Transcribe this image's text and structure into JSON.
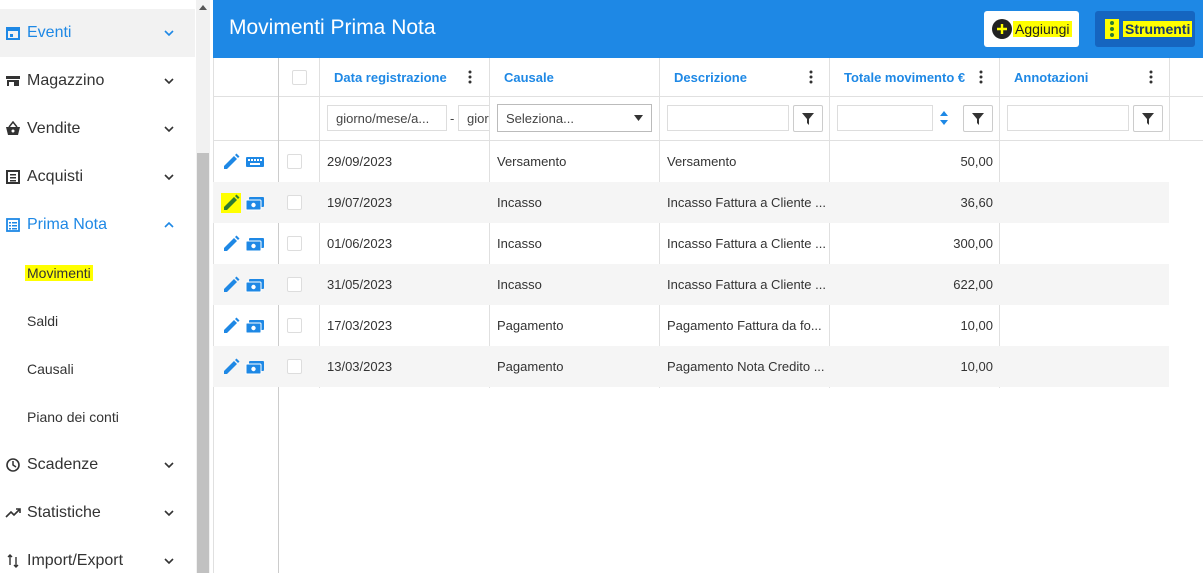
{
  "sidebar": {
    "items": [
      {
        "label": "Eventi",
        "icon": "calendar-icon"
      },
      {
        "label": "Magazzino",
        "icon": "store-icon"
      },
      {
        "label": "Vendite",
        "icon": "basket-icon"
      },
      {
        "label": "Acquisti",
        "icon": "receipt-icon"
      },
      {
        "label": "Prima Nota",
        "icon": "list-icon"
      },
      {
        "label": "Scadenze",
        "icon": "clock-icon"
      },
      {
        "label": "Statistiche",
        "icon": "trending-up-icon"
      },
      {
        "label": "Import/Export",
        "icon": "import-export-icon"
      }
    ],
    "subitems": [
      {
        "label": "Movimenti"
      },
      {
        "label": "Saldi"
      },
      {
        "label": "Causali"
      },
      {
        "label": "Piano dei conti"
      }
    ]
  },
  "header": {
    "title": "Movimenti Prima Nota",
    "add_label": "Aggiungi",
    "tools_label": "Strumenti"
  },
  "columns": {
    "date": "Data registrazione",
    "causale": "Causale",
    "descrizione": "Descrizione",
    "totale": "Totale movimento €",
    "annotazioni": "Annotazioni"
  },
  "filters": {
    "date_from_placeholder": "giorno/mese/a...",
    "date_separator": "-",
    "date_to_placeholder": "gior",
    "causale_select": "Seleziona..."
  },
  "rows": [
    {
      "date": "29/09/2023",
      "causale": "Versamento",
      "descrizione": "Versamento",
      "totale": "50,00",
      "annotazioni": ""
    },
    {
      "date": "19/07/2023",
      "causale": "Incasso",
      "descrizione": "Incasso Fattura a Cliente ...",
      "totale": "36,60",
      "annotazioni": ""
    },
    {
      "date": "01/06/2023",
      "causale": "Incasso",
      "descrizione": "Incasso Fattura a Cliente ...",
      "totale": "300,00",
      "annotazioni": ""
    },
    {
      "date": "31/05/2023",
      "causale": "Incasso",
      "descrizione": "Incasso Fattura a Cliente ...",
      "totale": "622,00",
      "annotazioni": ""
    },
    {
      "date": "17/03/2023",
      "causale": "Pagamento",
      "descrizione": "Pagamento Fattura da fo...",
      "totale": "10,00",
      "annotazioni": ""
    },
    {
      "date": "13/03/2023",
      "causale": "Pagamento",
      "descrizione": "Pagamento Nota Credito ...",
      "totale": "10,00",
      "annotazioni": ""
    }
  ],
  "colors": {
    "primary": "#1e88e5",
    "highlight": "#ffff00"
  }
}
